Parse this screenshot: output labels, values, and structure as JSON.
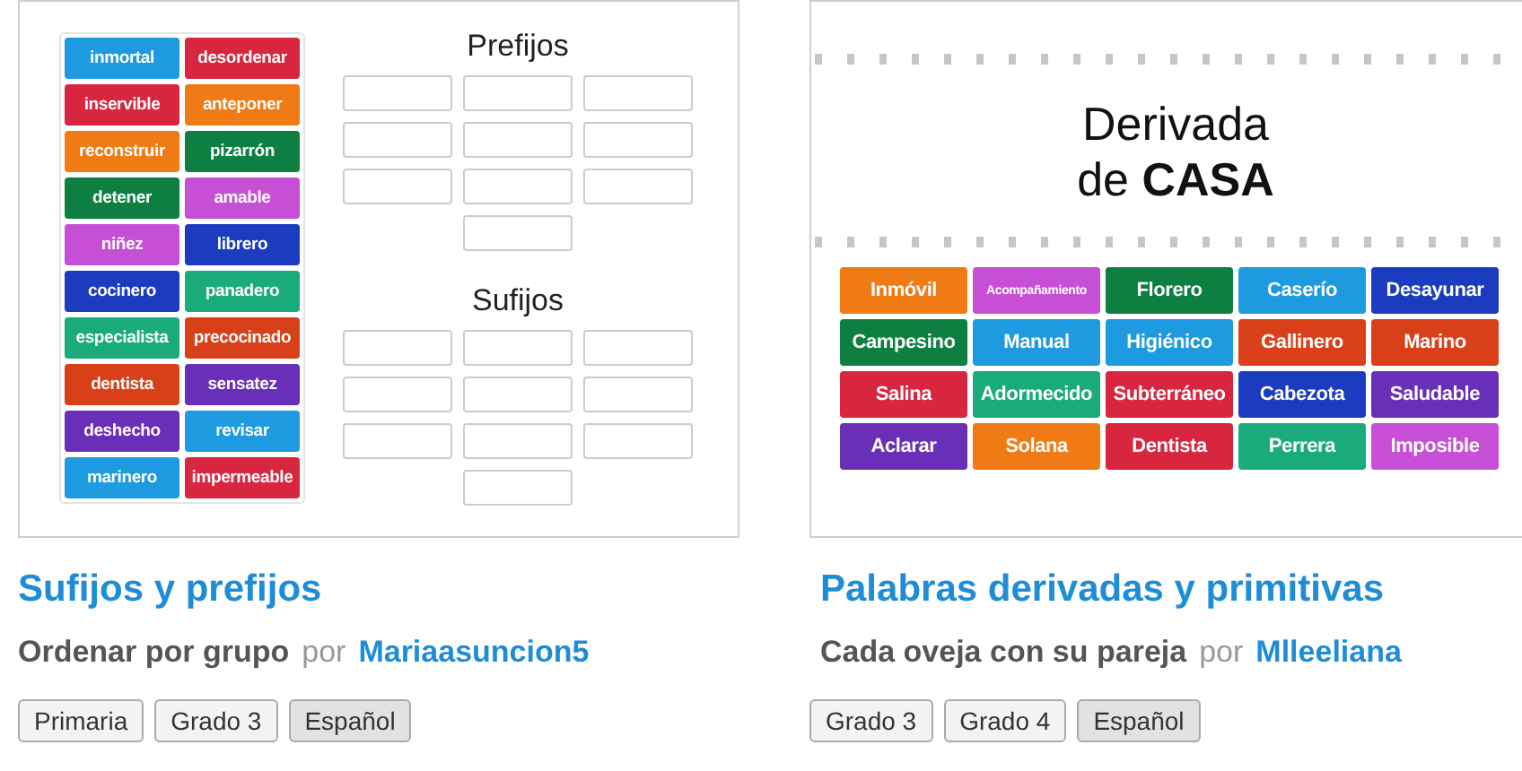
{
  "cards": [
    {
      "thumbnail": {
        "kind": "group_sort",
        "tiles": [
          {
            "text": "inmortal",
            "color": "#1e9be0"
          },
          {
            "text": "desordenar",
            "color": "#d9263f"
          },
          {
            "text": "inservible",
            "color": "#d9263f"
          },
          {
            "text": "anteponer",
            "color": "#f07a13"
          },
          {
            "text": "reconstruir",
            "color": "#f07a13"
          },
          {
            "text": "pizarrón",
            "color": "#0d8041"
          },
          {
            "text": "detener",
            "color": "#0d8041"
          },
          {
            "text": "amable",
            "color": "#c64fd6"
          },
          {
            "text": "niñez",
            "color": "#c64fd6"
          },
          {
            "text": "librero",
            "color": "#1b3cbf"
          },
          {
            "text": "cocinero",
            "color": "#1b3cbf"
          },
          {
            "text": "panadero",
            "color": "#1aab7c"
          },
          {
            "text": "especialista",
            "color": "#1aab7c"
          },
          {
            "text": "precocinado",
            "color": "#d9401a"
          },
          {
            "text": "dentista",
            "color": "#d9401a"
          },
          {
            "text": "sensatez",
            "color": "#6a2fb8"
          },
          {
            "text": "deshecho",
            "color": "#6a2fb8"
          },
          {
            "text": "revisar",
            "color": "#1e9be0"
          },
          {
            "text": "marinero",
            "color": "#1e9be0"
          },
          {
            "text": "impermeable",
            "color": "#d9263f"
          }
        ],
        "groups": [
          "Prefijos",
          "Sufijos"
        ]
      },
      "title": "Sufijos y prefijos",
      "type": "Ordenar por grupo",
      "by": "por",
      "author": "Mariaasuncion5",
      "tags": [
        {
          "label": "Primaria",
          "kind": "level"
        },
        {
          "label": "Grado 3",
          "kind": "level"
        },
        {
          "label": "Español",
          "kind": "subject"
        }
      ]
    },
    {
      "thumbnail": {
        "kind": "match_up",
        "heading": "Derivada",
        "heading_2": "de **CASA**",
        "tiles": [
          {
            "text": "Inmóvil",
            "color": "#f07a13"
          },
          {
            "text": "Acompañamiento",
            "color": "#c64fd6"
          },
          {
            "text": "Florero",
            "color": "#0d8041"
          },
          {
            "text": "Caserío",
            "color": "#1e9be0"
          },
          {
            "text": "Desayunar",
            "color": "#1b3cbf"
          },
          {
            "text": "Campesino",
            "color": "#0d8041"
          },
          {
            "text": "Manual",
            "color": "#1e9be0"
          },
          {
            "text": "Higiénico",
            "color": "#1e9be0"
          },
          {
            "text": "Gallinero",
            "color": "#d9401a"
          },
          {
            "text": "Marino",
            "color": "#d9401a"
          },
          {
            "text": "Salina",
            "color": "#d9263f"
          },
          {
            "text": "Adormecido",
            "color": "#1aab7c"
          },
          {
            "text": "Subterráneo",
            "color": "#d9263f"
          },
          {
            "text": "Cabezota",
            "color": "#1b3cbf"
          },
          {
            "text": "Saludable",
            "color": "#6a2fb8"
          },
          {
            "text": "Aclarar",
            "color": "#6a2fb8"
          },
          {
            "text": "Solana",
            "color": "#f07a13"
          },
          {
            "text": "Dentista",
            "color": "#d9263f"
          },
          {
            "text": "Perrera",
            "color": "#1aab7c"
          },
          {
            "text": "Imposible",
            "color": "#c64fd6"
          }
        ]
      },
      "title": "Palabras derivadas y primitivas",
      "type": "Cada oveja con su pareja",
      "by": "por",
      "author": "Mlleeliana",
      "tags": [
        {
          "label": "Grado 3",
          "kind": "level"
        },
        {
          "label": "Grado 4",
          "kind": "level"
        },
        {
          "label": "Español",
          "kind": "subject"
        }
      ]
    }
  ]
}
